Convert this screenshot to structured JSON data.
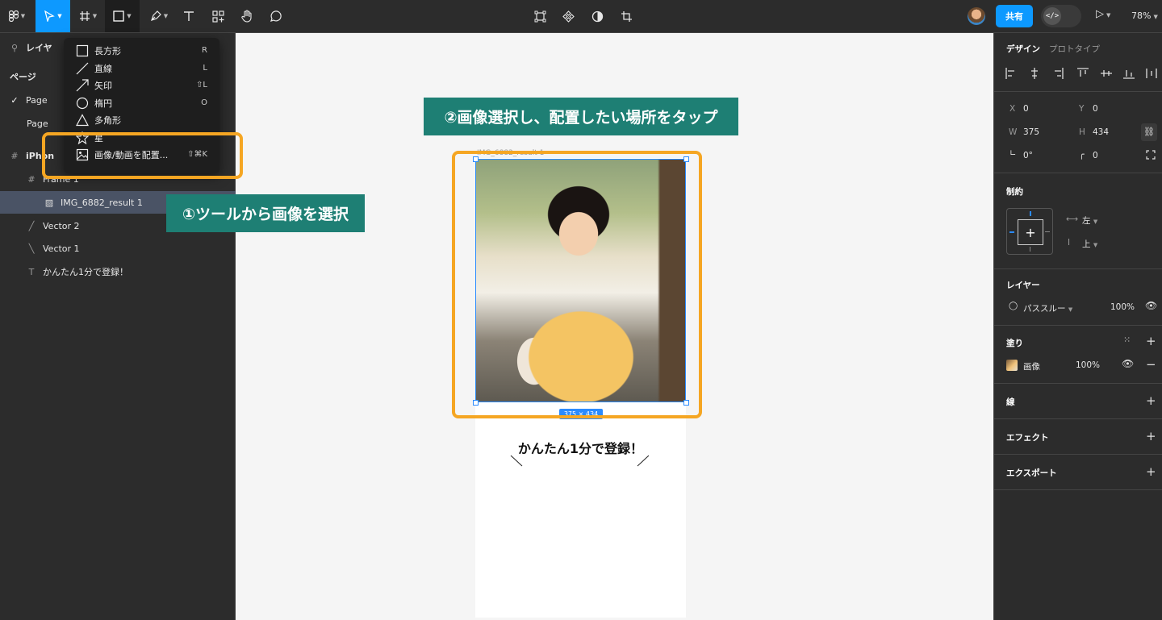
{
  "toolbar": {
    "tools": [
      "figma-menu",
      "move",
      "frame",
      "shape",
      "pen",
      "text",
      "components",
      "hand",
      "comment"
    ],
    "center_tools": [
      "edit-object",
      "component",
      "mask",
      "crop"
    ],
    "share_label": "共有",
    "dev_mode_label": "</>",
    "zoom": "78%"
  },
  "left_panel": {
    "search_label": "レイヤ",
    "pages_label": "ページ",
    "pages": [
      "Page",
      "Page"
    ],
    "layers": [
      {
        "name": "iPhon",
        "type": "frame"
      },
      {
        "name": "Frame 1",
        "type": "frame"
      },
      {
        "name": "IMG_6882_result 1",
        "type": "image"
      },
      {
        "name": "Vector 2",
        "type": "vector"
      },
      {
        "name": "Vector 1",
        "type": "vector"
      },
      {
        "name": "かんたん1分で登録！",
        "type": "text"
      }
    ]
  },
  "dropdown": {
    "items": [
      {
        "label": "長方形",
        "shortcut": "R",
        "icon": "rectangle-icon"
      },
      {
        "label": "直線",
        "shortcut": "L",
        "icon": "line-icon"
      },
      {
        "label": "矢印",
        "shortcut": "⇧L",
        "icon": "arrow-icon"
      },
      {
        "label": "楕円",
        "shortcut": "O",
        "icon": "ellipse-icon"
      },
      {
        "label": "多角形",
        "shortcut": "",
        "icon": "polygon-icon"
      },
      {
        "label": "星",
        "shortcut": "",
        "icon": "star-icon"
      },
      {
        "label": "画像/動画を配置...",
        "shortcut": "⇧⌘K",
        "icon": "image-icon"
      }
    ]
  },
  "callouts": {
    "step1": "①ツールから画像を選択",
    "step2": "②画像選択し、配置したい場所をタップ"
  },
  "canvas": {
    "frame_label": "IMG_6882_result 1",
    "dimensions": "375 × 434",
    "frame_text": "かんたん1分で登録！"
  },
  "right_panel": {
    "tabs": [
      "デザイン",
      "プロトタイプ"
    ],
    "x_label": "X",
    "x_value": "0",
    "y_label": "Y",
    "y_value": "0",
    "w_label": "W",
    "w_value": "375",
    "h_label": "H",
    "h_value": "434",
    "rotation": "0°",
    "radius": "0",
    "constraints_title": "制約",
    "constraint_h": "左",
    "constraint_v": "上",
    "layer_title": "レイヤー",
    "blend_mode": "パススルー",
    "layer_opacity": "100%",
    "fill_title": "塗り",
    "fill_type": "画像",
    "fill_opacity": "100%",
    "stroke_title": "線",
    "effects_title": "エフェクト",
    "export_title": "エクスポート"
  },
  "colors": {
    "accent": "#0d99ff",
    "highlight": "#f5a623",
    "callout_bg": "#1e7f74",
    "panel_bg": "#2c2c2c"
  }
}
